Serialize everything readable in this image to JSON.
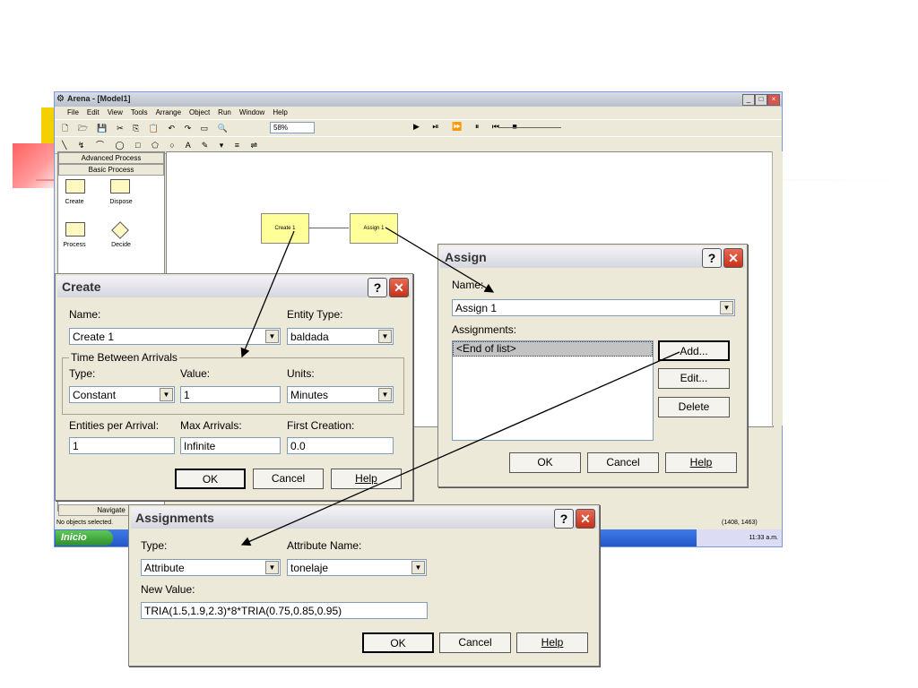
{
  "arena": {
    "title": "Arena - [Model1]",
    "menu": [
      "File",
      "Edit",
      "View",
      "Tools",
      "Arrange",
      "Object",
      "Run",
      "Window",
      "Help"
    ],
    "zoom": "58%",
    "panels": [
      "Advanced Process",
      "Basic Process"
    ],
    "modules": [
      "Create",
      "Dispose",
      "Process",
      "Decide"
    ],
    "navigate": "Navigate",
    "status_left": "No objects selected.",
    "status_coords": "(1408, 1463)",
    "start_label": "Inicio",
    "clock": "11:33 a.m.",
    "flow_create": "Create 1",
    "flow_assign": "Assign 1"
  },
  "create_dialog": {
    "title": "Create",
    "name_label": "Name:",
    "name_value": "Create 1",
    "entity_type_label": "Entity Type:",
    "entity_type_value": "baldada",
    "tba_group": "Time Between Arrivals",
    "type_label": "Type:",
    "type_value": "Constant",
    "value_label": "Value:",
    "value_value": "1",
    "units_label": "Units:",
    "units_value": "Minutes",
    "epa_label": "Entities per Arrival:",
    "epa_value": "1",
    "max_label": "Max Arrivals:",
    "max_value": "Infinite",
    "first_label": "First Creation:",
    "first_value": "0.0",
    "ok": "OK",
    "cancel": "Cancel",
    "help": "Help"
  },
  "assign_dialog": {
    "title": "Assign",
    "name_label": "Name:",
    "name_value": "Assign 1",
    "assignments_label": "Assignments:",
    "list_item": "<End of list>",
    "add": "Add...",
    "edit": "Edit...",
    "delete": "Delete",
    "ok": "OK",
    "cancel": "Cancel",
    "help": "Help"
  },
  "assignments_dialog": {
    "title": "Assignments",
    "type_label": "Type:",
    "type_value": "Attribute",
    "attr_label": "Attribute Name:",
    "attr_value": "tonelaje",
    "newval_label": "New Value:",
    "newval_value": "TRIA(1.5,1.9,2.3)*8*TRIA(0.75,0.85,0.95)",
    "ok": "OK",
    "cancel": "Cancel",
    "help": "Help"
  },
  "colors": {
    "accent_red": "#c8311a",
    "module_fill": "#ffff99",
    "taskbar": "#2457c9"
  }
}
